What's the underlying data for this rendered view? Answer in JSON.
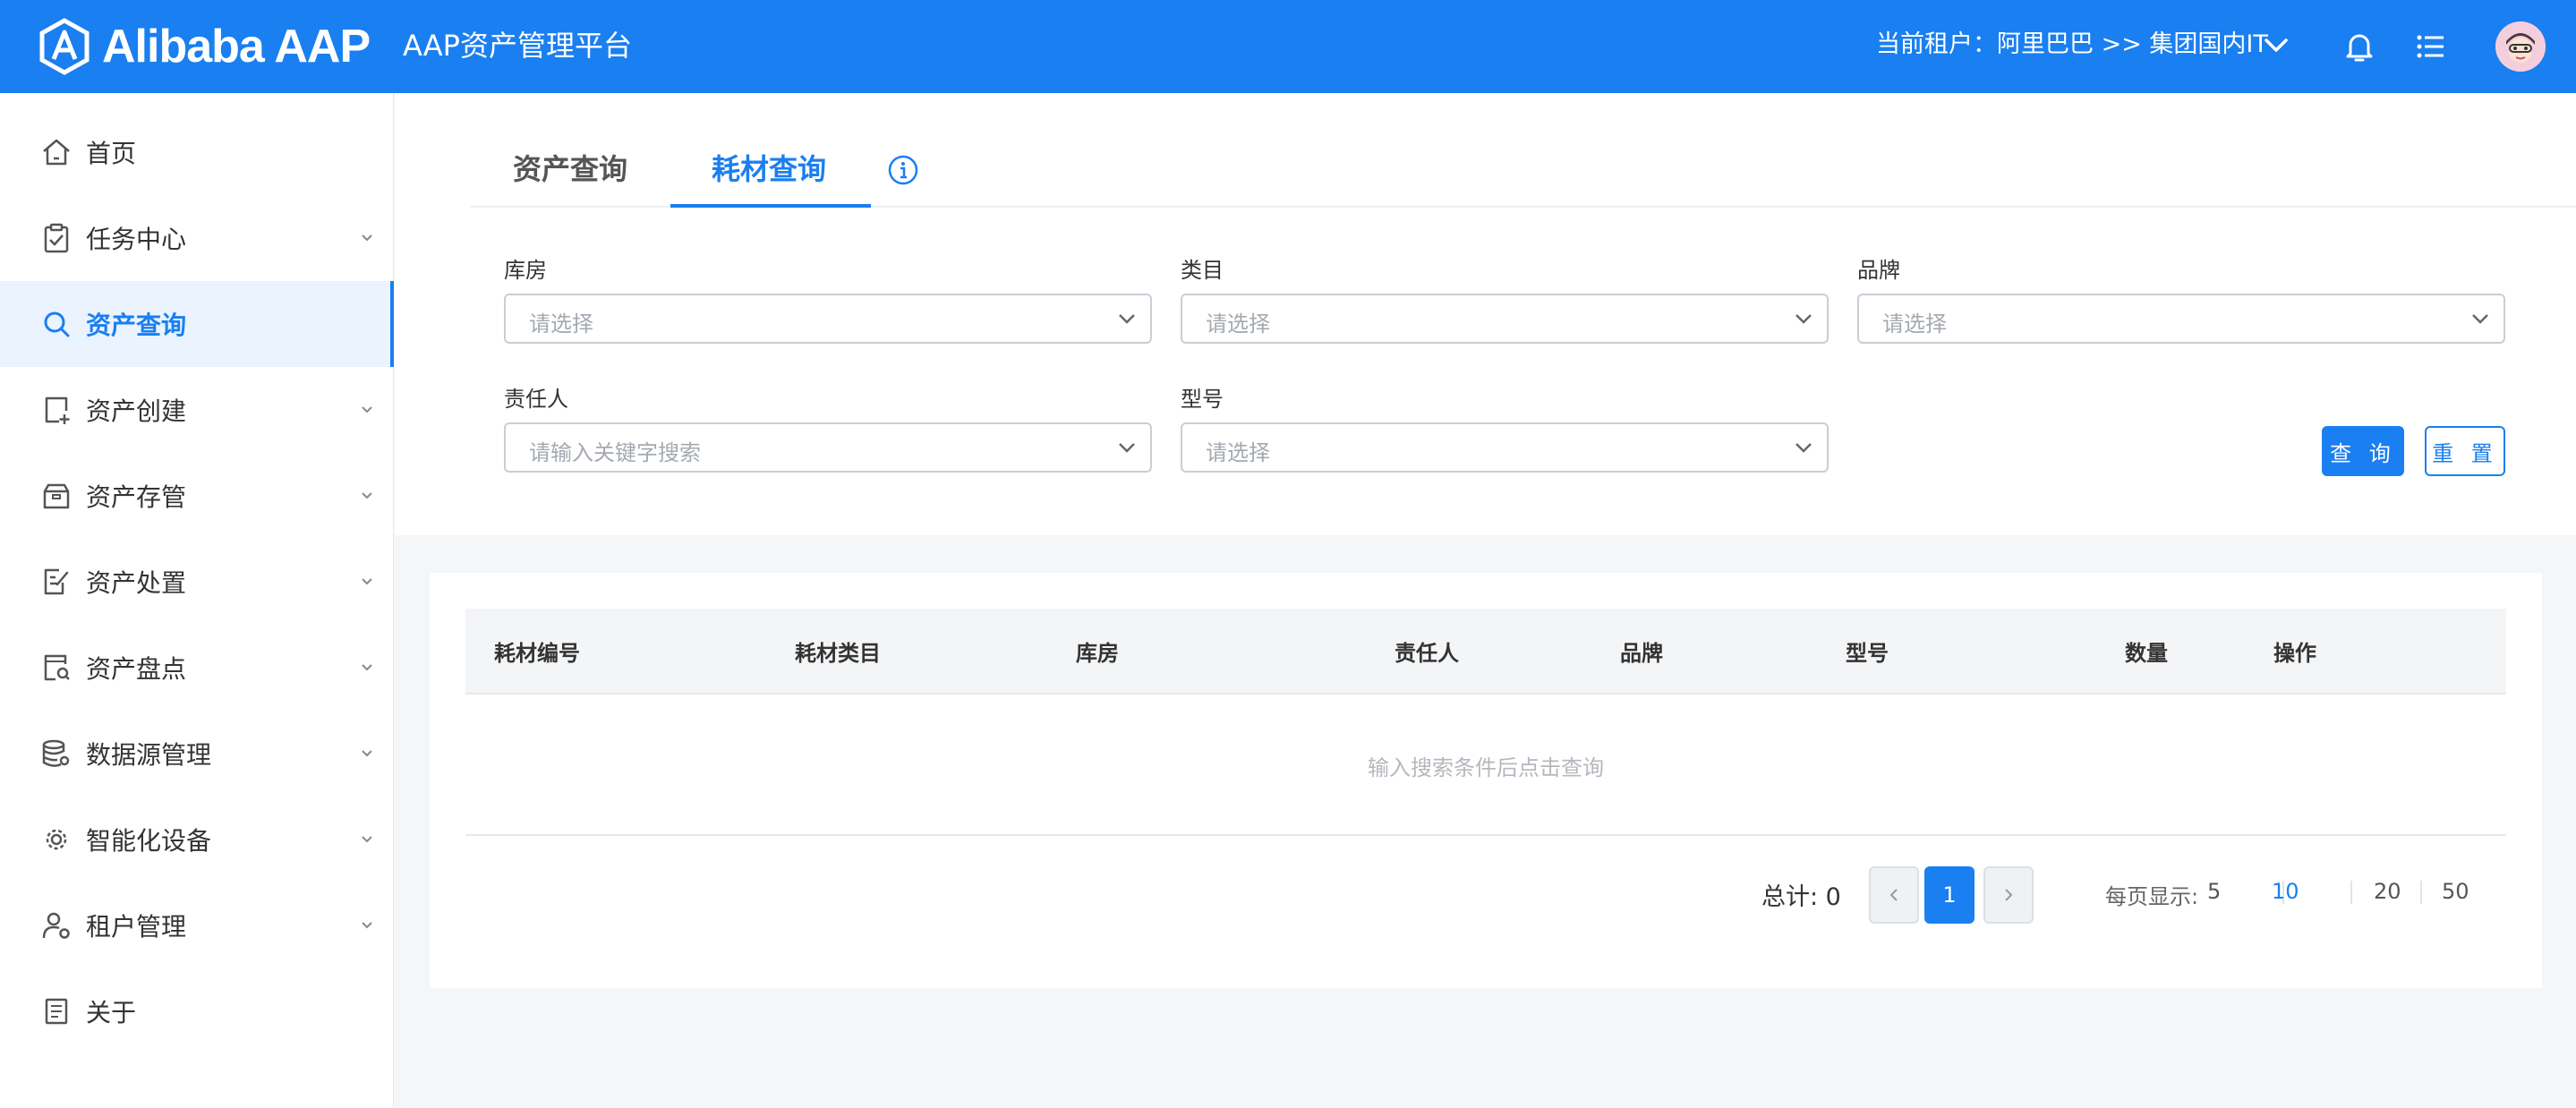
{
  "header": {
    "logo_text": "Alibaba AAP",
    "platform_title": "AAP资产管理平台",
    "tenant_text": "当前租户：阿里巴巴 >> 集团国内IT",
    "icons": [
      "chevron-down-icon",
      "bell-icon",
      "list-icon",
      "avatar"
    ]
  },
  "sidebar": {
    "items": [
      {
        "label": "首页",
        "icon": "home-icon",
        "expandable": false
      },
      {
        "label": "任务中心",
        "icon": "clipboard-check-icon",
        "expandable": true
      },
      {
        "label": "资产查询",
        "icon": "search-icon",
        "expandable": false,
        "active": true
      },
      {
        "label": "资产创建",
        "icon": "add-file-icon",
        "expandable": true
      },
      {
        "label": "资产存管",
        "icon": "box-icon",
        "expandable": true
      },
      {
        "label": "资产处置",
        "icon": "edit-document-icon",
        "expandable": true
      },
      {
        "label": "资产盘点",
        "icon": "inventory-search-icon",
        "expandable": true
      },
      {
        "label": "数据源管理",
        "icon": "database-gear-icon",
        "expandable": true
      },
      {
        "label": "智能化设备",
        "icon": "smart-device-icon",
        "expandable": true
      },
      {
        "label": "租户管理",
        "icon": "user-gear-icon",
        "expandable": true
      },
      {
        "label": "关于",
        "icon": "document-icon",
        "expandable": false
      }
    ]
  },
  "tabs": [
    {
      "label": "资产查询",
      "active": false
    },
    {
      "label": "耗材查询",
      "active": true
    }
  ],
  "filters": {
    "warehouse": {
      "label": "库房",
      "placeholder": "请选择"
    },
    "category": {
      "label": "类目",
      "placeholder": "请选择"
    },
    "brand": {
      "label": "品牌",
      "placeholder": "请选择"
    },
    "owner": {
      "label": "责任人",
      "placeholder": "请输入关键字搜索"
    },
    "model": {
      "label": "型号",
      "placeholder": "请选择"
    }
  },
  "buttons": {
    "query": "查 询",
    "reset": "重 置"
  },
  "table": {
    "columns": [
      "耗材编号",
      "耗材类目",
      "库房",
      "责任人",
      "品牌",
      "型号",
      "数量",
      "操作"
    ],
    "rows": [],
    "empty_text": "输入搜索条件后点击查询"
  },
  "pagination": {
    "total_text": "总计: 0",
    "current_page": "1",
    "page_size_label": "每页显示:",
    "page_sizes": [
      "5",
      "10",
      "20",
      "50"
    ],
    "selected_page_size": "10"
  },
  "colors": {
    "primary": "#1a7ff0",
    "header_bg": "#1a7ff0",
    "active_bg": "#eaf3fe"
  }
}
